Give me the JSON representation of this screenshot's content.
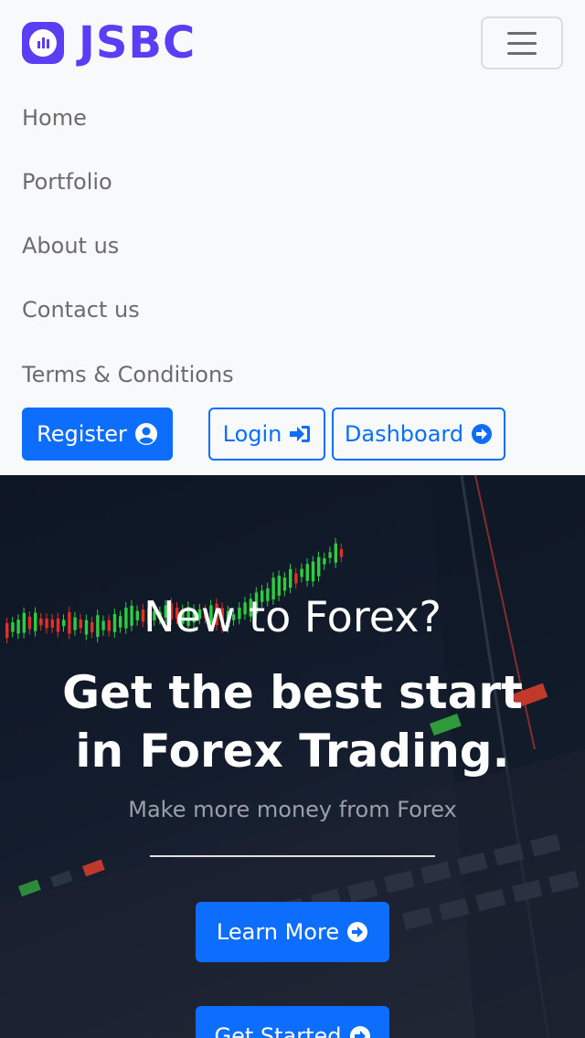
{
  "brand": {
    "name": "JSBC",
    "icon": "chart-logo-icon",
    "color": "#5b3df5"
  },
  "nav": {
    "toggler_icon": "hamburger-icon",
    "items": [
      {
        "label": "Home"
      },
      {
        "label": "Portfolio"
      },
      {
        "label": "About us"
      },
      {
        "label": "Contact us"
      },
      {
        "label": "Terms & Conditions"
      }
    ],
    "buttons": {
      "register": {
        "label": "Register",
        "icon": "user-circle-icon"
      },
      "login": {
        "label": "Login",
        "icon": "sign-in-icon"
      },
      "dashboard": {
        "label": "Dashboard",
        "icon": "arrow-circle-right-icon"
      }
    }
  },
  "hero": {
    "heading_small": "New to Forex?",
    "heading_big_line1": "Get the best start",
    "heading_big_line2": "in Forex Trading.",
    "subtitle": "Make more money from Forex",
    "learn_more": {
      "label": "Learn More",
      "icon": "arrow-circle-right-icon"
    },
    "get_started": {
      "label": "Get Started",
      "icon": "arrow-circle-right-icon"
    }
  },
  "colors": {
    "primary": "#0d6efd",
    "nav_text": "#6c6c6c",
    "background": "#f8f9fa"
  }
}
